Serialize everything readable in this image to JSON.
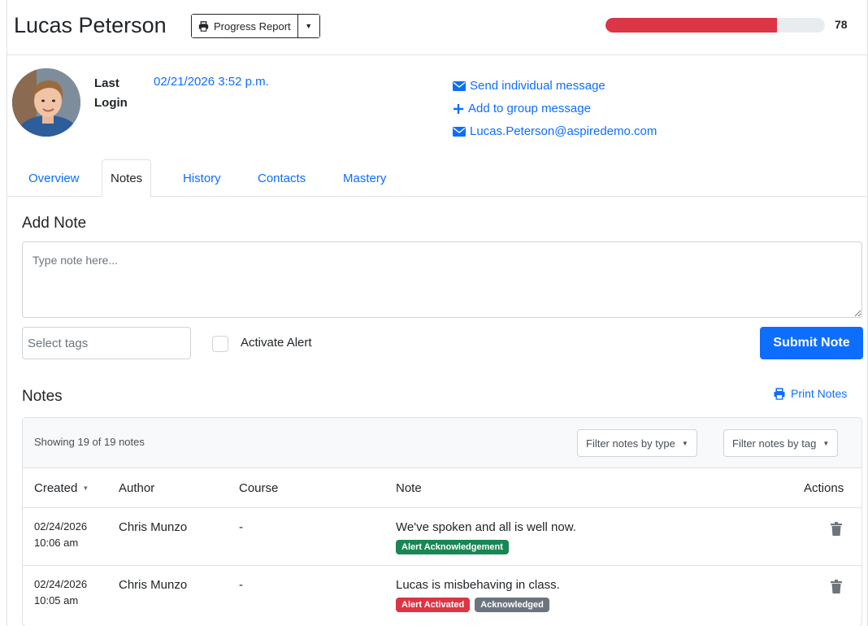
{
  "header": {
    "student_name": "Lucas Peterson",
    "report_button_label": "Progress Report",
    "progress_value": "78",
    "progress_fraction": 0.78,
    "progress_color": "#dc3545"
  },
  "profile": {
    "last_login_label": "Last Login",
    "last_login_value": "02/21/2026 3:52 p.m.",
    "links": {
      "send_message": "Send individual message",
      "add_group": "Add to group message",
      "email": "Lucas.Peterson@aspiredemo.com"
    }
  },
  "tabs": {
    "overview": "Overview",
    "notes": "Notes",
    "history": "History",
    "contacts": "Contacts",
    "mastery": "Mastery",
    "active": "notes"
  },
  "add_note": {
    "title": "Add Note",
    "textarea_placeholder": "Type note here...",
    "tags_placeholder": "Select tags",
    "alert_label": "Activate Alert",
    "submit_label": "Submit Note"
  },
  "notes": {
    "title": "Notes",
    "print_label": "Print Notes",
    "showing_text": "Showing 19 of 19 notes",
    "filter_type_label": "Filter notes by type",
    "filter_tag_label": "Filter notes by tag",
    "columns": {
      "created": "Created",
      "author": "Author",
      "course": "Course",
      "note": "Note",
      "actions": "Actions"
    },
    "rows": [
      {
        "date": "02/24/2026",
        "time": "10:06 am",
        "author": "Chris Munzo",
        "course": "-",
        "note": "We've spoken and all is well now.",
        "badges": [
          {
            "label": "Alert Acknowledgement",
            "color": "#198754"
          }
        ]
      },
      {
        "date": "02/24/2026",
        "time": "10:05 am",
        "author": "Chris Munzo",
        "course": "-",
        "note": "Lucas is misbehaving in class.",
        "badges": [
          {
            "label": "Alert Activated",
            "color": "#dc3545"
          },
          {
            "label": "Acknowledged",
            "color": "#6c757d"
          }
        ]
      }
    ]
  },
  "colors": {
    "link": "#0d6efd",
    "primary_button": "#0d6efd",
    "success_badge": "#198754",
    "danger_badge": "#dc3545",
    "secondary_badge": "#6c757d"
  }
}
